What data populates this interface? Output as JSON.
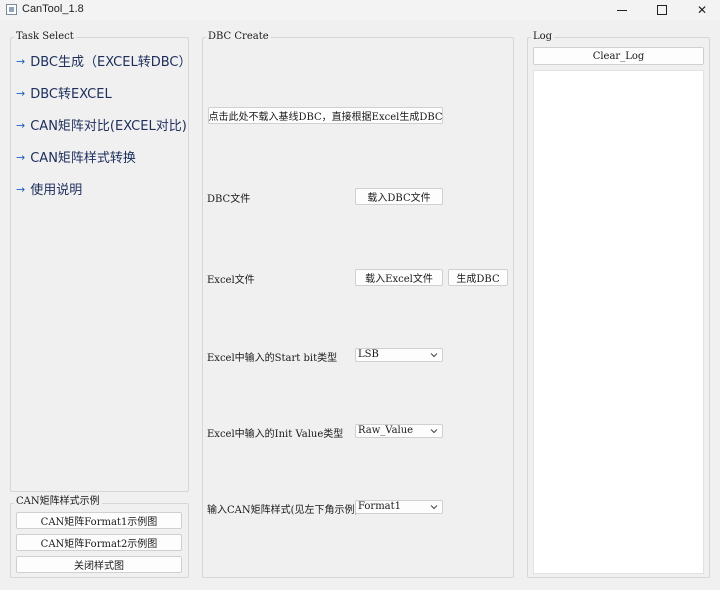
{
  "window": {
    "title": "CanTool_1.8",
    "min_icon": "minimize-icon",
    "max_icon": "maximize-icon",
    "close_glyph": "✕"
  },
  "task_panel": {
    "title": "Task Select",
    "arrow": "→",
    "items": [
      {
        "label": "DBC生成（EXCEL转DBC）"
      },
      {
        "label": "DBC转EXCEL"
      },
      {
        "label": "CAN矩阵对比(EXCEL对比)"
      },
      {
        "label": "CAN矩阵样式转换"
      },
      {
        "label": "使用说明"
      }
    ]
  },
  "example_panel": {
    "title": "CAN矩阵样式示例",
    "buttons": [
      {
        "label": "CAN矩阵Format1示例图"
      },
      {
        "label": "CAN矩阵Format2示例图"
      },
      {
        "label": "关闭样式图"
      }
    ]
  },
  "dbc_panel": {
    "title": "DBC Create",
    "no_baseline_button": "点击此处不载入基线DBC，直接根据Excel生成DBC",
    "dbc_file_label": "DBC文件",
    "load_dbc_button": "载入DBC文件",
    "excel_file_label": "Excel文件",
    "load_excel_button": "载入Excel文件",
    "generate_dbc_button": "生成DBC",
    "start_bit_label": "Excel中输入的Start bit类型",
    "start_bit_value": "LSB",
    "init_value_label": "Excel中输入的Init Value类型",
    "init_value_value": "Raw_Value",
    "format_label": "输入CAN矩阵样式(见左下角示例)",
    "format_value": "Format1"
  },
  "log_panel": {
    "title": "Log",
    "clear_button": "Clear_Log"
  }
}
